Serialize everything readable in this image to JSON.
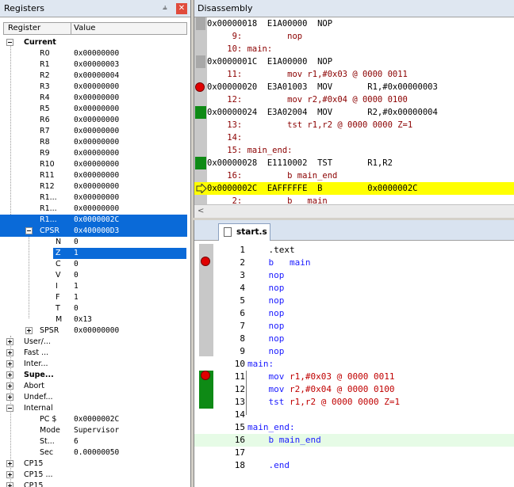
{
  "registers": {
    "title": "Registers",
    "pin_glyph": "⫨",
    "close_glyph": "✕",
    "col_register": "Register",
    "col_value": "Value",
    "current_label": "Current",
    "rows": [
      {
        "name": "R0",
        "value": "0x00000000"
      },
      {
        "name": "R1",
        "value": "0x00000003"
      },
      {
        "name": "R2",
        "value": "0x00000004"
      },
      {
        "name": "R3",
        "value": "0x00000000"
      },
      {
        "name": "R4",
        "value": "0x00000000"
      },
      {
        "name": "R5",
        "value": "0x00000000"
      },
      {
        "name": "R6",
        "value": "0x00000000"
      },
      {
        "name": "R7",
        "value": "0x00000000"
      },
      {
        "name": "R8",
        "value": "0x00000000"
      },
      {
        "name": "R9",
        "value": "0x00000000"
      },
      {
        "name": "R10",
        "value": "0x00000000"
      },
      {
        "name": "R11",
        "value": "0x00000000"
      },
      {
        "name": "R12",
        "value": "0x00000000"
      },
      {
        "name": "R1...",
        "value": "0x00000000"
      },
      {
        "name": "R1...",
        "value": "0x00000000"
      },
      {
        "name": "R1...",
        "value": "0x0000002C"
      }
    ],
    "cpsr": {
      "name": "CPSR",
      "value": "0x400000D3"
    },
    "flags": [
      {
        "name": "N",
        "value": "0"
      },
      {
        "name": "Z",
        "value": "1"
      },
      {
        "name": "C",
        "value": "0"
      },
      {
        "name": "V",
        "value": "0"
      },
      {
        "name": "I",
        "value": "1"
      },
      {
        "name": "F",
        "value": "1"
      },
      {
        "name": "T",
        "value": "0"
      },
      {
        "name": "M",
        "value": "0x13"
      }
    ],
    "spsr": {
      "name": "SPSR",
      "value": "0x00000000"
    },
    "groups": [
      "User/...",
      "Fast ...",
      "Inter...",
      "Supe...",
      "Abort",
      "Undef..."
    ],
    "internal": {
      "label": "Internal",
      "items": [
        {
          "name": "PC  $",
          "value": "0x0000002C"
        },
        {
          "name": "Mode",
          "value": "Supervisor"
        },
        {
          "name": "St...",
          "value": "6"
        },
        {
          "name": "Sec",
          "value": "0.00000050"
        }
      ]
    },
    "cp15": [
      "CP15",
      "CP15 ...",
      "CP15"
    ]
  },
  "disassembly": {
    "title": "Disassembly",
    "scroll_left_glyph": "<",
    "lines": [
      {
        "text": "0x00000018  E1A00000  NOP",
        "kind": "asm"
      },
      {
        "text": "     9:         nop",
        "kind": "src"
      },
      {
        "text": "    10: main:",
        "kind": "src"
      },
      {
        "text": "0x0000001C  E1A00000  NOP",
        "kind": "asm"
      },
      {
        "text": "    11:         mov r1,#0x03 @ 0000 0011",
        "kind": "src"
      },
      {
        "text": "0x00000020  E3A01003  MOV       R1,#0x00000003",
        "kind": "asm"
      },
      {
        "text": "    12:         mov r2,#0x04 @ 0000 0100",
        "kind": "src"
      },
      {
        "text": "0x00000024  E3A02004  MOV       R2,#0x00000004",
        "kind": "asm"
      },
      {
        "text": "    13:         tst r1,r2 @ 0000 0000 Z=1",
        "kind": "src"
      },
      {
        "text": "    14:",
        "kind": "src"
      },
      {
        "text": "    15: main_end:",
        "kind": "src"
      },
      {
        "text": "0x00000028  E1110002  TST       R1,R2",
        "kind": "asm"
      },
      {
        "text": "    16:         b main_end",
        "kind": "src"
      },
      {
        "text": "0x0000002C  EAFFFFFE  B         0x0000002C",
        "kind": "cur"
      },
      {
        "text": "     2:         b   main",
        "kind": "src"
      }
    ]
  },
  "source": {
    "tab_label": "start.s",
    "lines": [
      {
        "n": "1",
        "code": [
          {
            "t": "    .text",
            "c": ""
          }
        ]
      },
      {
        "n": "2",
        "code": [
          {
            "t": "    b   main",
            "c": "kw"
          }
        ]
      },
      {
        "n": "3",
        "code": [
          {
            "t": "    nop",
            "c": "kw"
          }
        ]
      },
      {
        "n": "4",
        "code": [
          {
            "t": "    nop",
            "c": "kw"
          }
        ]
      },
      {
        "n": "5",
        "code": [
          {
            "t": "    nop",
            "c": "kw"
          }
        ]
      },
      {
        "n": "6",
        "code": [
          {
            "t": "    nop",
            "c": "kw"
          }
        ]
      },
      {
        "n": "7",
        "code": [
          {
            "t": "    nop",
            "c": "kw"
          }
        ]
      },
      {
        "n": "8",
        "code": [
          {
            "t": "    nop",
            "c": "kw"
          }
        ]
      },
      {
        "n": "9",
        "code": [
          {
            "t": "    nop",
            "c": "kw"
          }
        ]
      },
      {
        "n": "10",
        "code": [
          {
            "t": "main:",
            "c": "lbl"
          }
        ]
      },
      {
        "n": "11",
        "code": [
          {
            "t": "    mov ",
            "c": "kw"
          },
          {
            "t": "r1",
            "c": "red"
          },
          {
            "t": ",#0x03 @ 0000 0011",
            "c": "red"
          }
        ]
      },
      {
        "n": "12",
        "code": [
          {
            "t": "    mov ",
            "c": "kw"
          },
          {
            "t": "r2",
            "c": "red"
          },
          {
            "t": ",#0x04 @ 0000 0100",
            "c": "red"
          }
        ]
      },
      {
        "n": "13",
        "code": [
          {
            "t": "    tst ",
            "c": "kw"
          },
          {
            "t": "r1,r2",
            "c": "red"
          },
          {
            "t": " @ 0000 0000 Z=1",
            "c": "red"
          }
        ]
      },
      {
        "n": "14",
        "code": [
          {
            "t": "",
            "c": ""
          }
        ]
      },
      {
        "n": "15",
        "code": [
          {
            "t": "main_end:",
            "c": "lbl"
          }
        ]
      },
      {
        "n": "16",
        "code": [
          {
            "t": "    b main_end",
            "c": "kw"
          }
        ]
      },
      {
        "n": "17",
        "code": [
          {
            "t": "",
            "c": ""
          }
        ]
      },
      {
        "n": "18",
        "code": [
          {
            "t": "    .end",
            "c": "kw"
          }
        ]
      }
    ]
  }
}
